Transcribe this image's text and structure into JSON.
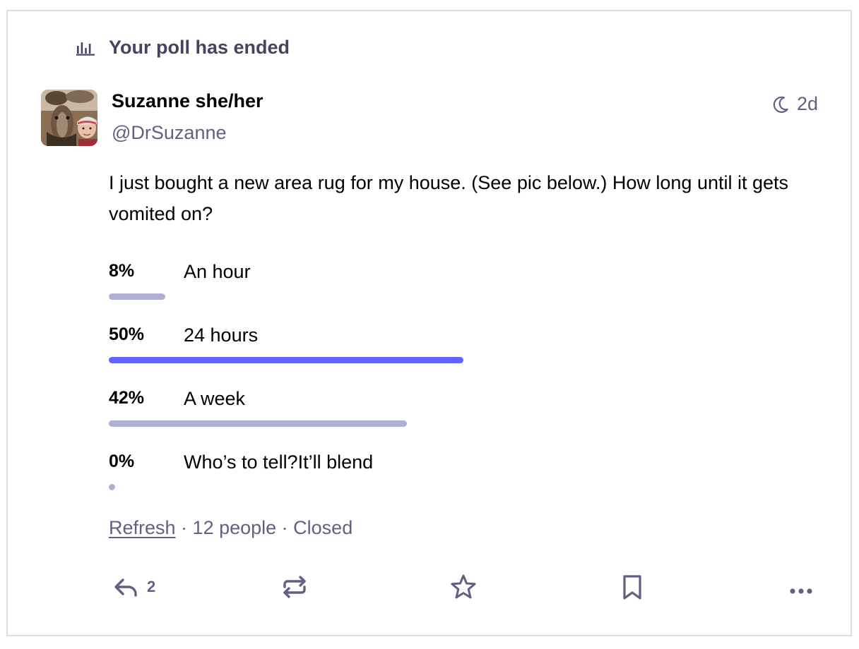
{
  "prepend": {
    "text": "Your poll has ended",
    "icon": "bar-chart-icon"
  },
  "status": {
    "display_name": "Suzanne she/her",
    "handle": "@DrSuzanne",
    "time": "2d",
    "visibility_icon": "moon-icon",
    "content": "I just bought a new area rug for my house. (See pic below.) How long until it gets vomited on?"
  },
  "poll": {
    "options": [
      {
        "percent_label": "8%",
        "percent": 8,
        "label": "An hour",
        "leading": false
      },
      {
        "percent_label": "50%",
        "percent": 50,
        "label": "24 hours",
        "leading": true
      },
      {
        "percent_label": "42%",
        "percent": 42,
        "label": "A week",
        "leading": false
      },
      {
        "percent_label": "0%",
        "percent": 0,
        "label": "Who’s to tell?It’ll blend",
        "leading": false
      }
    ],
    "refresh_label": "Refresh",
    "voters": "12 people",
    "state": "Closed",
    "separator": " · "
  },
  "actions": {
    "reply_count": "2",
    "icons": [
      "reply-icon",
      "boost-icon",
      "favourite-icon",
      "bookmark-icon",
      "more-icon"
    ]
  },
  "colors": {
    "accent": "#6364ff",
    "bar": "#afb0d1",
    "secondary_text": "#606085",
    "heading_text": "#444462",
    "border": "#dddee5"
  }
}
